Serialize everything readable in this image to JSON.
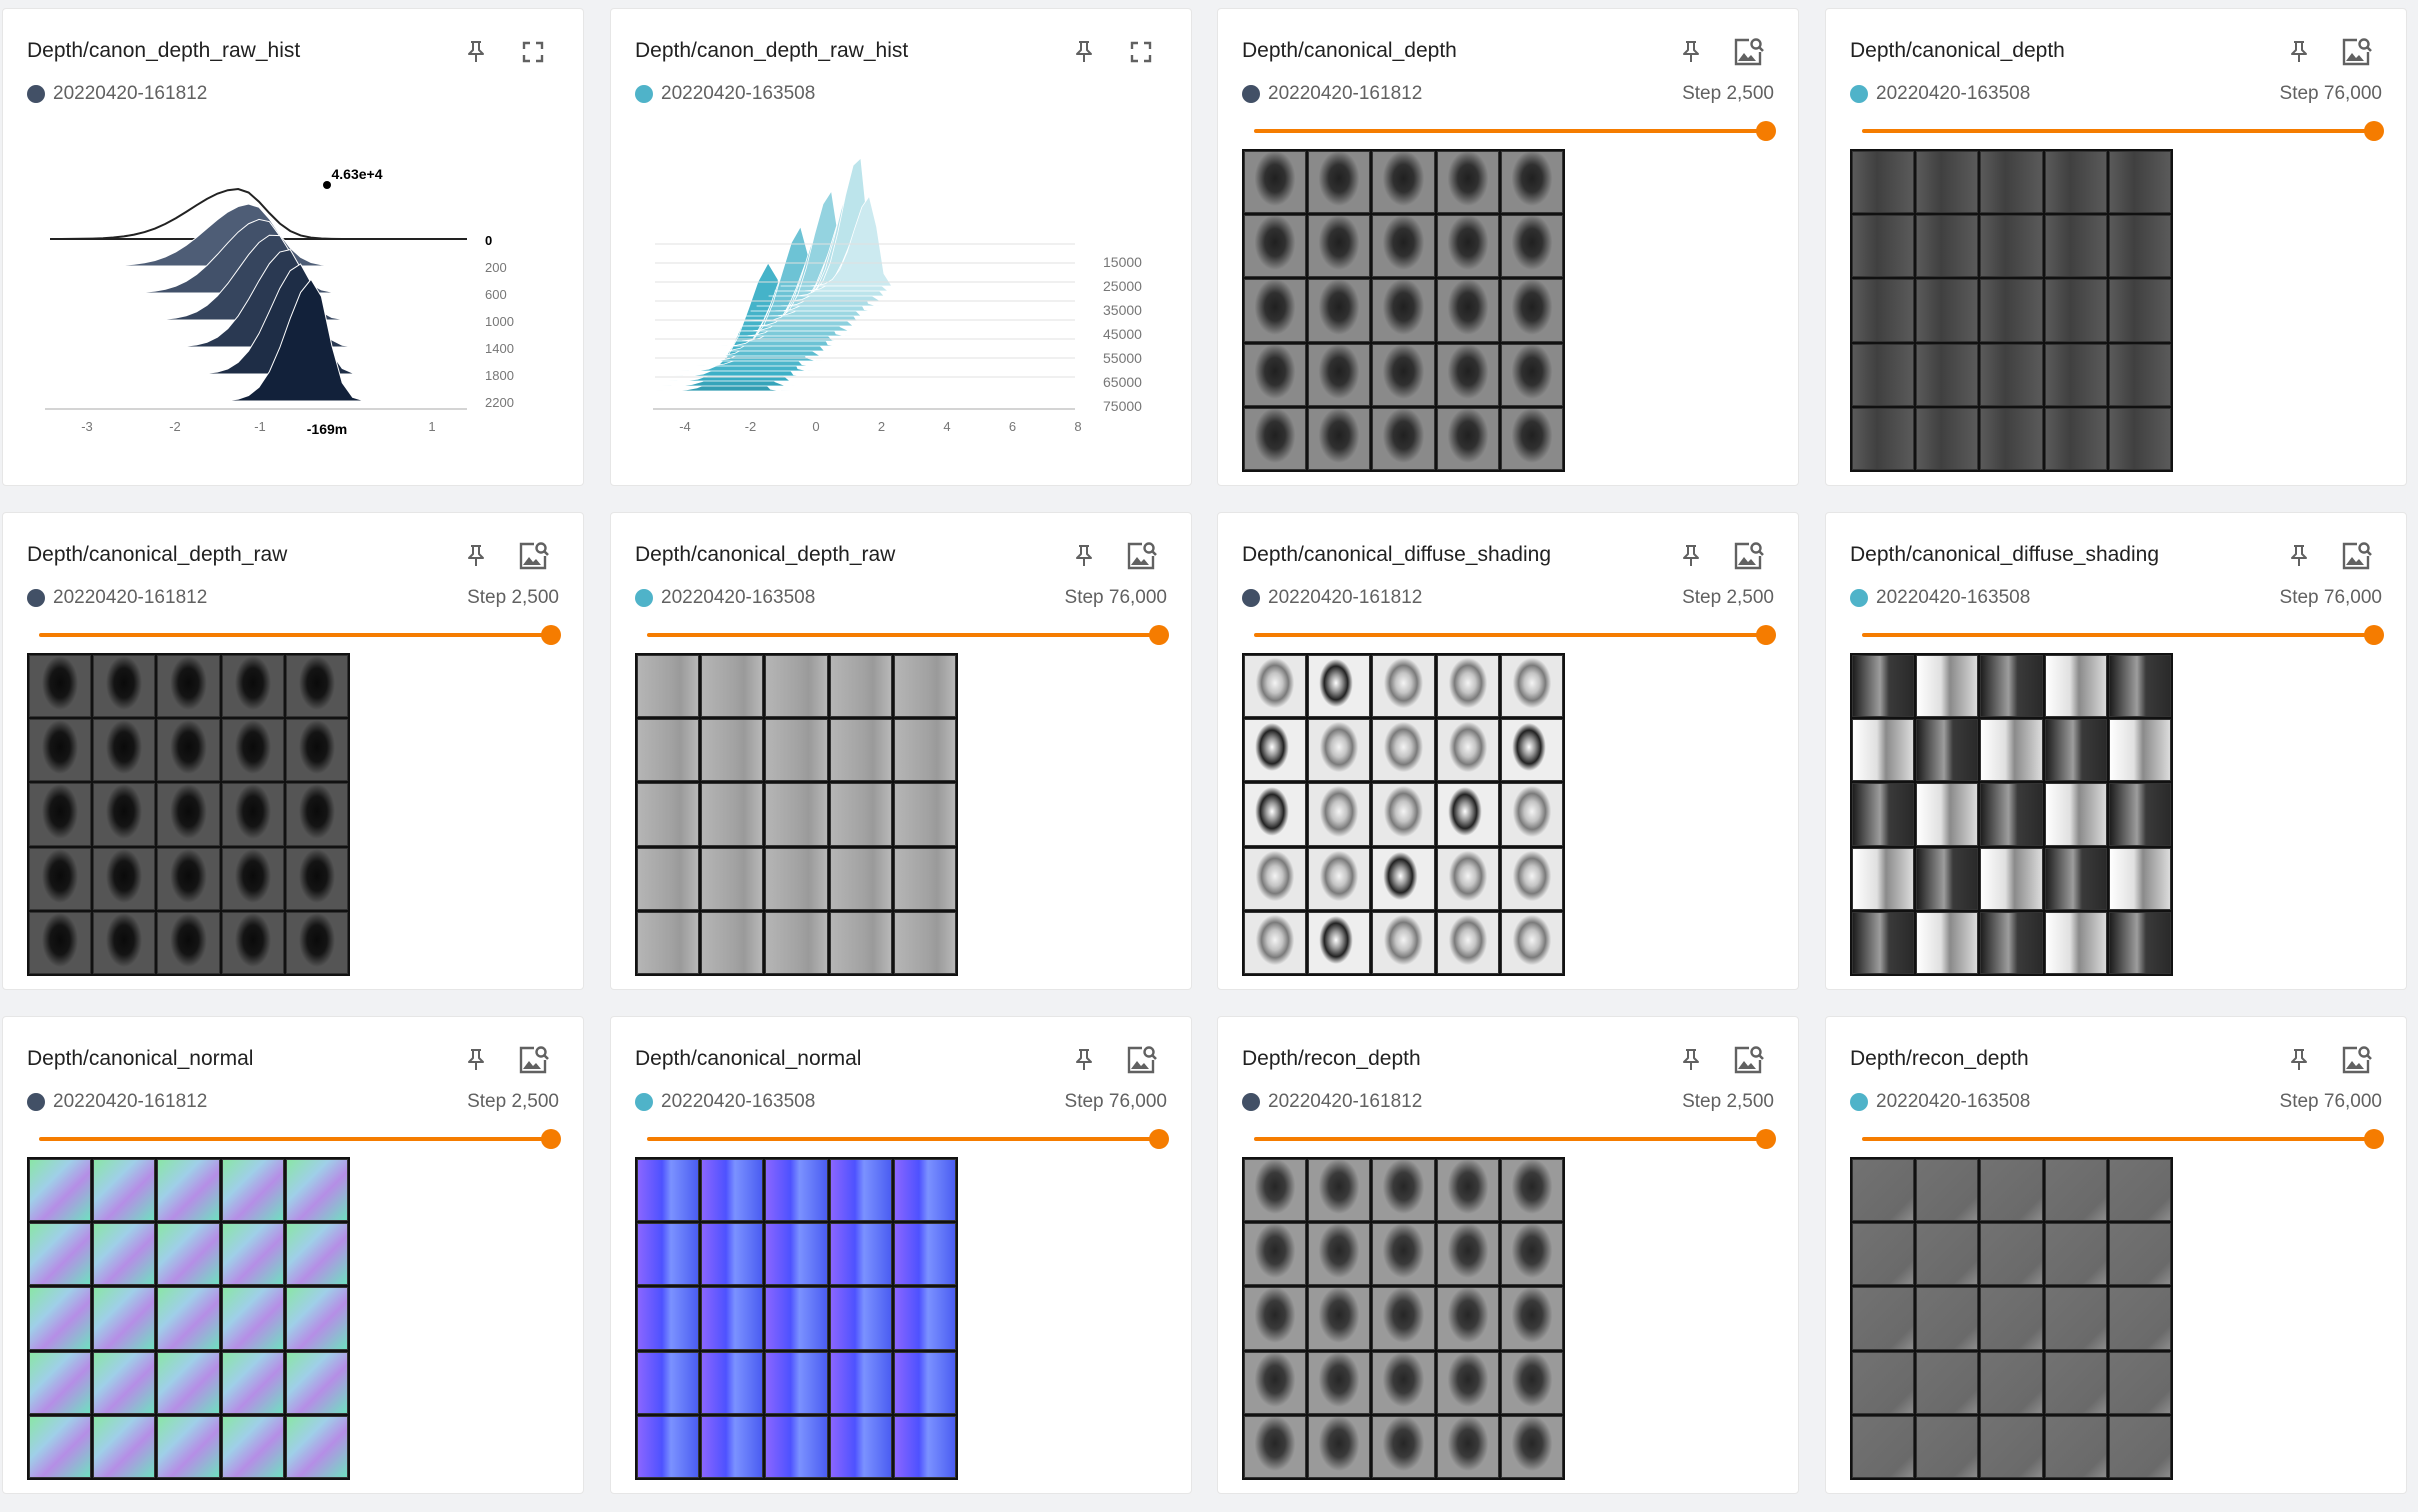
{
  "cards": [
    {
      "title": "Depth/canon_depth_raw_hist",
      "run": "20220420-161812",
      "run_color": "#425066",
      "action": "fullscreen-icon",
      "kind": "histogram-offset",
      "chart_data": {
        "type": "histogram",
        "mode": "offset",
        "x_ticks": [
          "-3",
          "-2",
          "-1",
          "1"
        ],
        "y_ticks": [
          "0",
          "200",
          "600",
          "1000",
          "1400",
          "1800",
          "2200"
        ],
        "hover_value": "4.63e+4",
        "hover_x": "-169m",
        "color": "#425066"
      }
    },
    {
      "title": "Depth/canon_depth_raw_hist",
      "run": "20220420-163508",
      "run_color": "#4fb3c9",
      "action": "fullscreen-icon",
      "kind": "histogram-overlay",
      "chart_data": {
        "type": "histogram",
        "mode": "offset",
        "x_ticks": [
          "-4",
          "-2",
          "0",
          "2",
          "4",
          "6",
          "8"
        ],
        "y_ticks": [
          "15000",
          "25000",
          "35000",
          "45000",
          "55000",
          "65000",
          "75000"
        ],
        "color": "#4fb3c9"
      }
    },
    {
      "title": "Depth/canonical_depth",
      "run": "20220420-161812",
      "run_color": "#425066",
      "step": "Step 2,500",
      "step_fraction": 1,
      "action": "image-search-icon",
      "kind": "images",
      "style": "depth-soft"
    },
    {
      "title": "Depth/canonical_depth",
      "run": "20220420-163508",
      "run_color": "#4fb3c9",
      "step": "Step 76,000",
      "step_fraction": 1,
      "action": "image-search-icon",
      "kind": "images",
      "style": "depth-flat"
    },
    {
      "title": "Depth/canonical_depth_raw",
      "run": "20220420-161812",
      "run_color": "#425066",
      "step": "Step 2,500",
      "step_fraction": 1,
      "action": "image-search-icon",
      "kind": "images",
      "style": "raw-dark"
    },
    {
      "title": "Depth/canonical_depth_raw",
      "run": "20220420-163508",
      "run_color": "#4fb3c9",
      "step": "Step 76,000",
      "step_fraction": 1,
      "action": "image-search-icon",
      "kind": "images",
      "style": "raw-light"
    },
    {
      "title": "Depth/canonical_diffuse_shading",
      "run": "20220420-161812",
      "run_color": "#425066",
      "step": "Step 2,500",
      "step_fraction": 1,
      "action": "image-search-icon",
      "kind": "images",
      "style": "shading-faces"
    },
    {
      "title": "Depth/canonical_diffuse_shading",
      "run": "20220420-163508",
      "run_color": "#4fb3c9",
      "step": "Step 76,000",
      "step_fraction": 1,
      "action": "image-search-icon",
      "kind": "images",
      "style": "shading-blocks"
    },
    {
      "title": "Depth/canonical_normal",
      "run": "20220420-161812",
      "run_color": "#425066",
      "step": "Step 2,500",
      "step_fraction": 1,
      "action": "image-search-icon",
      "kind": "images",
      "style": "normal-rainbow"
    },
    {
      "title": "Depth/canonical_normal",
      "run": "20220420-163508",
      "run_color": "#4fb3c9",
      "step": "Step 76,000",
      "step_fraction": 1,
      "action": "image-search-icon",
      "kind": "images",
      "style": "normal-violet"
    },
    {
      "title": "Depth/recon_depth",
      "run": "20220420-161812",
      "run_color": "#425066",
      "step": "Step 2,500",
      "step_fraction": 1,
      "action": "image-search-icon",
      "kind": "images",
      "style": "recon-soft"
    },
    {
      "title": "Depth/recon_depth",
      "run": "20220420-163508",
      "run_color": "#4fb3c9",
      "step": "Step 76,000",
      "step_fraction": 1,
      "action": "image-search-icon",
      "kind": "images",
      "style": "recon-flat"
    }
  ]
}
